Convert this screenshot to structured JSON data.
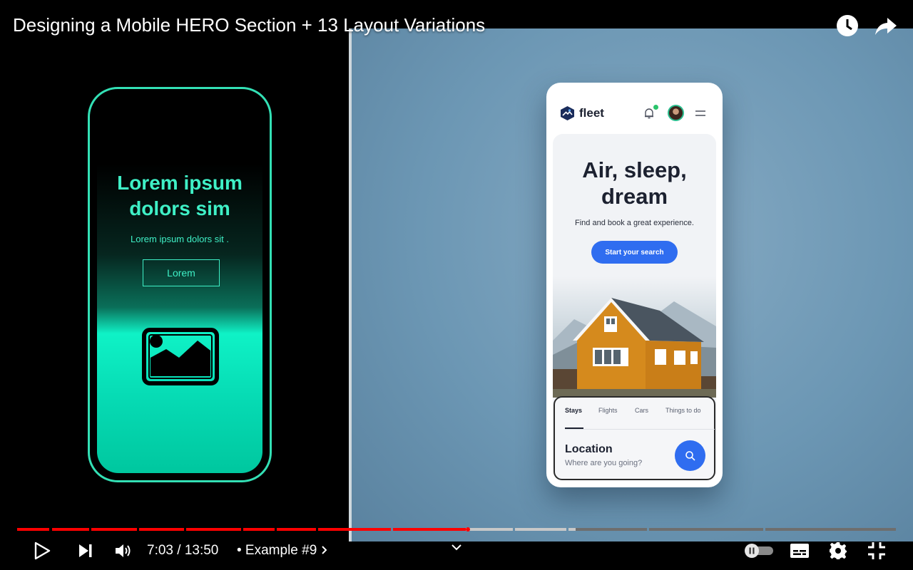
{
  "video": {
    "title": "Designing a Mobile HERO Section + 13 Layout Variations"
  },
  "left_mock": {
    "title": "Lorem ipsum dolors sim",
    "subtitle": "Lorem ipsum dolors sit .",
    "button": "Lorem",
    "accent": "#3ff0c6"
  },
  "app": {
    "brand": "fleet",
    "hero_title": "Air, sleep, dream",
    "hero_subtitle": "Find and book a great experience.",
    "cta": "Start your search",
    "tabs": [
      {
        "label": "Stays",
        "active": true
      },
      {
        "label": "Flights",
        "active": false
      },
      {
        "label": "Cars",
        "active": false
      },
      {
        "label": "Things to do",
        "active": false
      }
    ],
    "location_label": "Location",
    "location_placeholder": "Where are you going?",
    "accent": "#2f6df0"
  },
  "player": {
    "current_time": "7:03",
    "duration": "13:50",
    "time_display": "7:03 / 13:50",
    "chapter": "• Example #9",
    "played_fraction": 0.51,
    "colors": {
      "played": "#ff0000",
      "buffered": "#c8c8c8",
      "unplayed": "#6e6e6e"
    }
  },
  "icons": [
    "clock-icon",
    "share-icon",
    "play-icon",
    "next-icon",
    "volume-icon",
    "chevron-right-icon",
    "chevron-down-icon",
    "autoplay-toggle",
    "captions-icon",
    "settings-icon",
    "exit-fullscreen-icon"
  ]
}
